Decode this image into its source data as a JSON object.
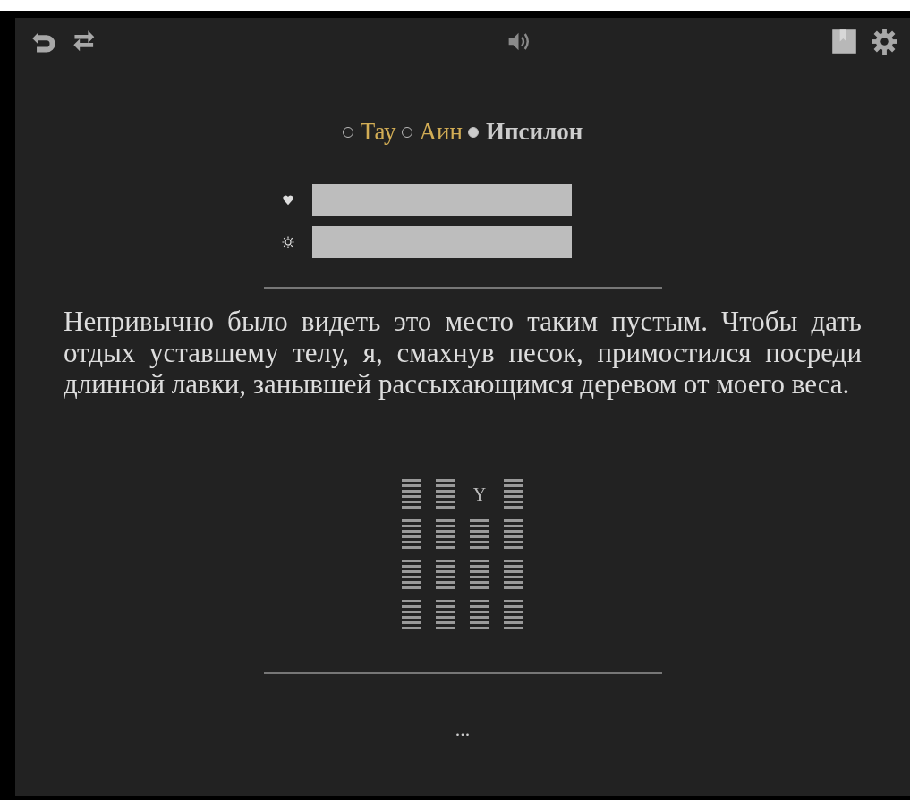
{
  "toolbar": {
    "left": [
      {
        "kind": "undo"
      },
      {
        "kind": "swap"
      }
    ],
    "center": [
      {
        "kind": "sound"
      }
    ],
    "right": [
      {
        "kind": "bookmark"
      },
      {
        "kind": "settings"
      }
    ]
  },
  "options": [
    {
      "label": "Тау",
      "selected": false
    },
    {
      "label": "Аин",
      "selected": false
    },
    {
      "label": "Ипсилон",
      "selected": true
    }
  ],
  "meters": [
    {
      "kind": "heart",
      "level": 1
    },
    {
      "kind": "sun",
      "level": 1
    }
  ],
  "paragraph": "Непривычно было видеть это место таким пустым. Чтобы дать отдых уставшему телу, я, смахнув песок, примостился посреди длинной лавки, занывшей рассыхающимся деревом от моего веса.",
  "grid": [
    [
      {
        "kind": "hatch"
      },
      {
        "kind": "hatch"
      },
      {
        "kind": "letter",
        "text": "Y"
      },
      {
        "kind": "hatch"
      }
    ],
    [
      {
        "kind": "hatch"
      },
      {
        "kind": "hatch"
      },
      {
        "kind": "hatch"
      },
      {
        "kind": "hatch"
      }
    ],
    [
      {
        "kind": "hatch"
      },
      {
        "kind": "hatch"
      },
      {
        "kind": "hatch"
      },
      {
        "kind": "hatch"
      }
    ],
    [
      {
        "kind": "hatch"
      },
      {
        "kind": "hatch"
      },
      {
        "kind": "hatch"
      },
      {
        "kind": "hatch"
      }
    ]
  ],
  "footer": "..."
}
